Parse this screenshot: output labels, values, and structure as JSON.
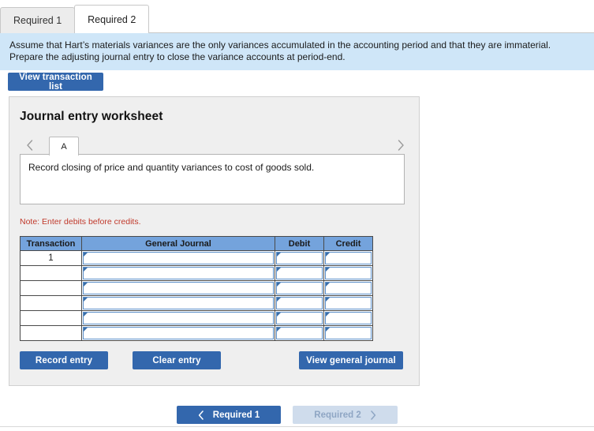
{
  "requirement_tabs": [
    {
      "label": "Required 1",
      "active": false
    },
    {
      "label": "Required 2",
      "active": true
    }
  ],
  "instructions": {
    "line1": "Assume that Hart’s materials variances are the only variances accumulated in the accounting period and that they are immaterial.",
    "line2": "Prepare the adjusting journal entry to close the variance accounts at period-end."
  },
  "toolbar": {
    "view_transaction_list_label": "View transaction list"
  },
  "worksheet": {
    "title": "Journal entry worksheet",
    "prev_icon": "chevron-left-icon",
    "next_icon": "chevron-right-icon",
    "entry_tab_label": "A",
    "description": "Record closing of price and quantity variances to cost of goods sold.",
    "note": "Note: Enter debits before credits.",
    "table": {
      "headers": [
        "Transaction",
        "General Journal",
        "Debit",
        "Credit"
      ],
      "rows": [
        {
          "transaction": "1",
          "general_journal": "",
          "debit": "",
          "credit": ""
        },
        {
          "transaction": "",
          "general_journal": "",
          "debit": "",
          "credit": ""
        },
        {
          "transaction": "",
          "general_journal": "",
          "debit": "",
          "credit": ""
        },
        {
          "transaction": "",
          "general_journal": "",
          "debit": "",
          "credit": ""
        },
        {
          "transaction": "",
          "general_journal": "",
          "debit": "",
          "credit": ""
        },
        {
          "transaction": "",
          "general_journal": "",
          "debit": "",
          "credit": ""
        }
      ]
    },
    "actions": {
      "record_label": "Record entry",
      "clear_label": "Clear entry",
      "view_journal_label": "View general journal"
    }
  },
  "pager": {
    "prev_label": "Required 1",
    "prev_icon": "chevron-left-icon",
    "next_label": "Required 2",
    "next_icon": "chevron-right-icon",
    "next_disabled": true
  },
  "colors": {
    "accent_blue": "#3367ad",
    "banner_blue": "#cfe6f8",
    "table_header_blue": "#74a3dc",
    "disabled_blue": "#cfdcec",
    "note_red": "#c0392b",
    "panel_gray": "#efefef"
  }
}
